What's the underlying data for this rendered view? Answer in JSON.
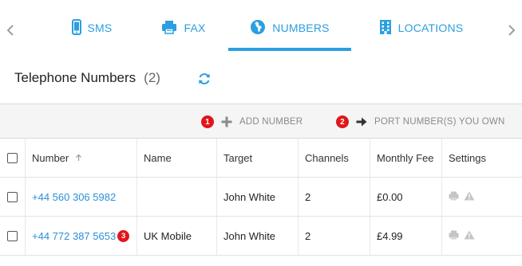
{
  "tabs": [
    {
      "label": "SMS",
      "icon": "phone-icon"
    },
    {
      "label": "FAX",
      "icon": "fax-icon"
    },
    {
      "label": "NUMBERS",
      "icon": "globe-icon",
      "active": true
    },
    {
      "label": "LOCATIONS",
      "icon": "building-icon"
    }
  ],
  "header": {
    "title": "Telephone Numbers",
    "count": "(2)"
  },
  "actions": {
    "add": {
      "badge": "1",
      "label": "ADD NUMBER"
    },
    "port": {
      "badge": "2",
      "label": "PORT NUMBER(S) YOU OWN"
    }
  },
  "table": {
    "columns": [
      "Number",
      "Name",
      "Target",
      "Channels",
      "Monthly Fee",
      "Settings"
    ],
    "rows": [
      {
        "number": "+44 560 306 5982",
        "name": "",
        "target": "John White",
        "channels": "2",
        "fee": "£0.00"
      },
      {
        "number": "+44 772 387 5653",
        "badge": "3",
        "name": "UK Mobile",
        "target": "John White",
        "channels": "2",
        "fee": "£4.99"
      }
    ]
  },
  "colors": {
    "accent": "#2b9fe0",
    "badge": "#e0161b",
    "link": "#2b8fd9"
  }
}
